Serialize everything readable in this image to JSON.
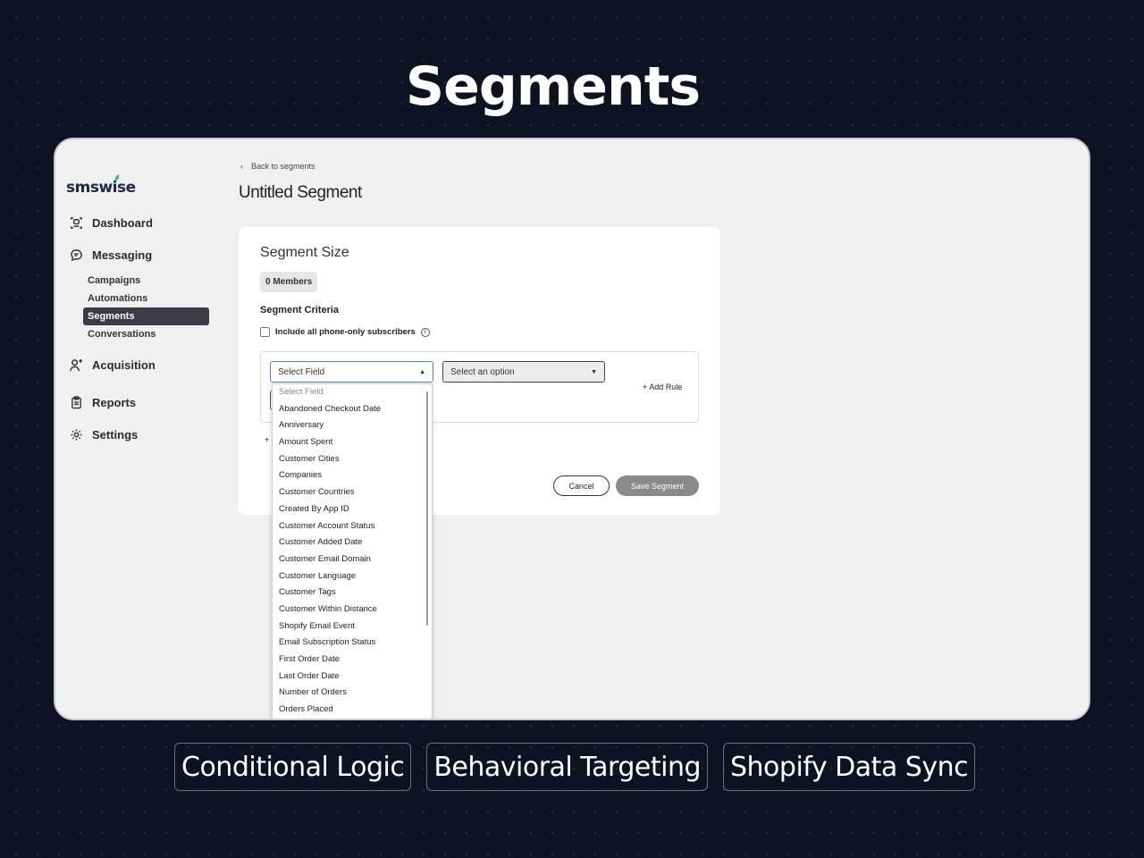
{
  "hero": {
    "title": "Segments"
  },
  "sidebar": {
    "logo": "smswise",
    "nav": [
      {
        "label": "Dashboard",
        "icon": "dashboard-icon"
      },
      {
        "label": "Messaging",
        "icon": "chat-bubble-icon"
      },
      {
        "label": "Acquisition",
        "icon": "add-user-icon"
      },
      {
        "label": "Reports",
        "icon": "clipboard-icon"
      },
      {
        "label": "Settings",
        "icon": "gear-icon"
      }
    ],
    "messaging_sub": [
      "Campaigns",
      "Automations",
      "Segments",
      "Conversations"
    ],
    "active_sub": "Segments"
  },
  "main": {
    "back_link": "Back to segments",
    "page_title": "Untitled Segment",
    "card": {
      "title": "Segment Size",
      "members": "0 Members",
      "criteria_label": "Segment Criteria",
      "checkbox_label": "Include all phone-only subscribers",
      "select_field_value": "Select Field",
      "select_option_placeholder": "Select an option",
      "add_rule": "+ Add Rule",
      "plus_stub": "+",
      "cancel": "Cancel",
      "save": "Save Segment"
    },
    "dropdown_options": [
      "Select Field",
      "Abandoned Checkout Date",
      "Anniversary",
      "Amount Spent",
      "Customer Cities",
      "Companies",
      "Customer Countries",
      "Created By App ID",
      "Customer Account Status",
      "Customer Added Date",
      "Customer Email Domain",
      "Customer Language",
      "Customer Tags",
      "Customer Within Distance",
      "Shopify Email Event",
      "Email Subscription Status",
      "First Order Date",
      "Last Order Date",
      "Number of Orders",
      "Orders Placed"
    ]
  },
  "features": [
    "Conditional Logic",
    "Behavioral Targeting",
    "Shopify Data Sync"
  ]
}
